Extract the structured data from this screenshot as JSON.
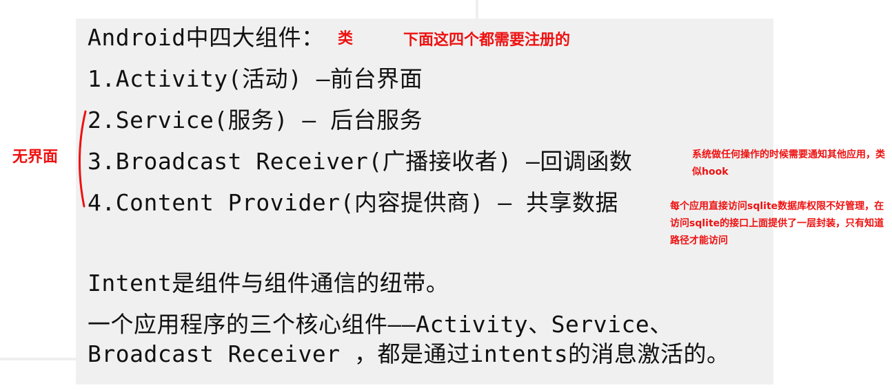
{
  "slide": {
    "heading": "Android中四大组件：",
    "items": [
      "1.Activity(活动) –前台界面",
      "2.Service(服务)   – 后台服务",
      "3.Broadcast Receiver(广播接收者) –回调函数",
      "4.Content Provider(内容提供商) –  共享数据"
    ],
    "intent_line": "Intent是组件与组件通信的纽带。",
    "core_line1": "一个应用程序的三个核心组件——Activity、Service、",
    "core_line2": "Broadcast Receiver ，都是通过intents的消息激活的。"
  },
  "annotations": {
    "class_label": "类",
    "register_note": "下面这四个都需要注册的",
    "no_ui_label": "无界面",
    "broadcast_note": "系统做任何操作的时候需要通知其他应用，类似hook",
    "provider_note": "每个应用直接访问sqlite数据库权限不好管理，在访问sqlite的接口上面提供了一层封装，只有知道路径才能访问"
  },
  "colors": {
    "annotation": "#ee1111",
    "slide_bg": "#f0f0f0",
    "text": "#111111"
  }
}
